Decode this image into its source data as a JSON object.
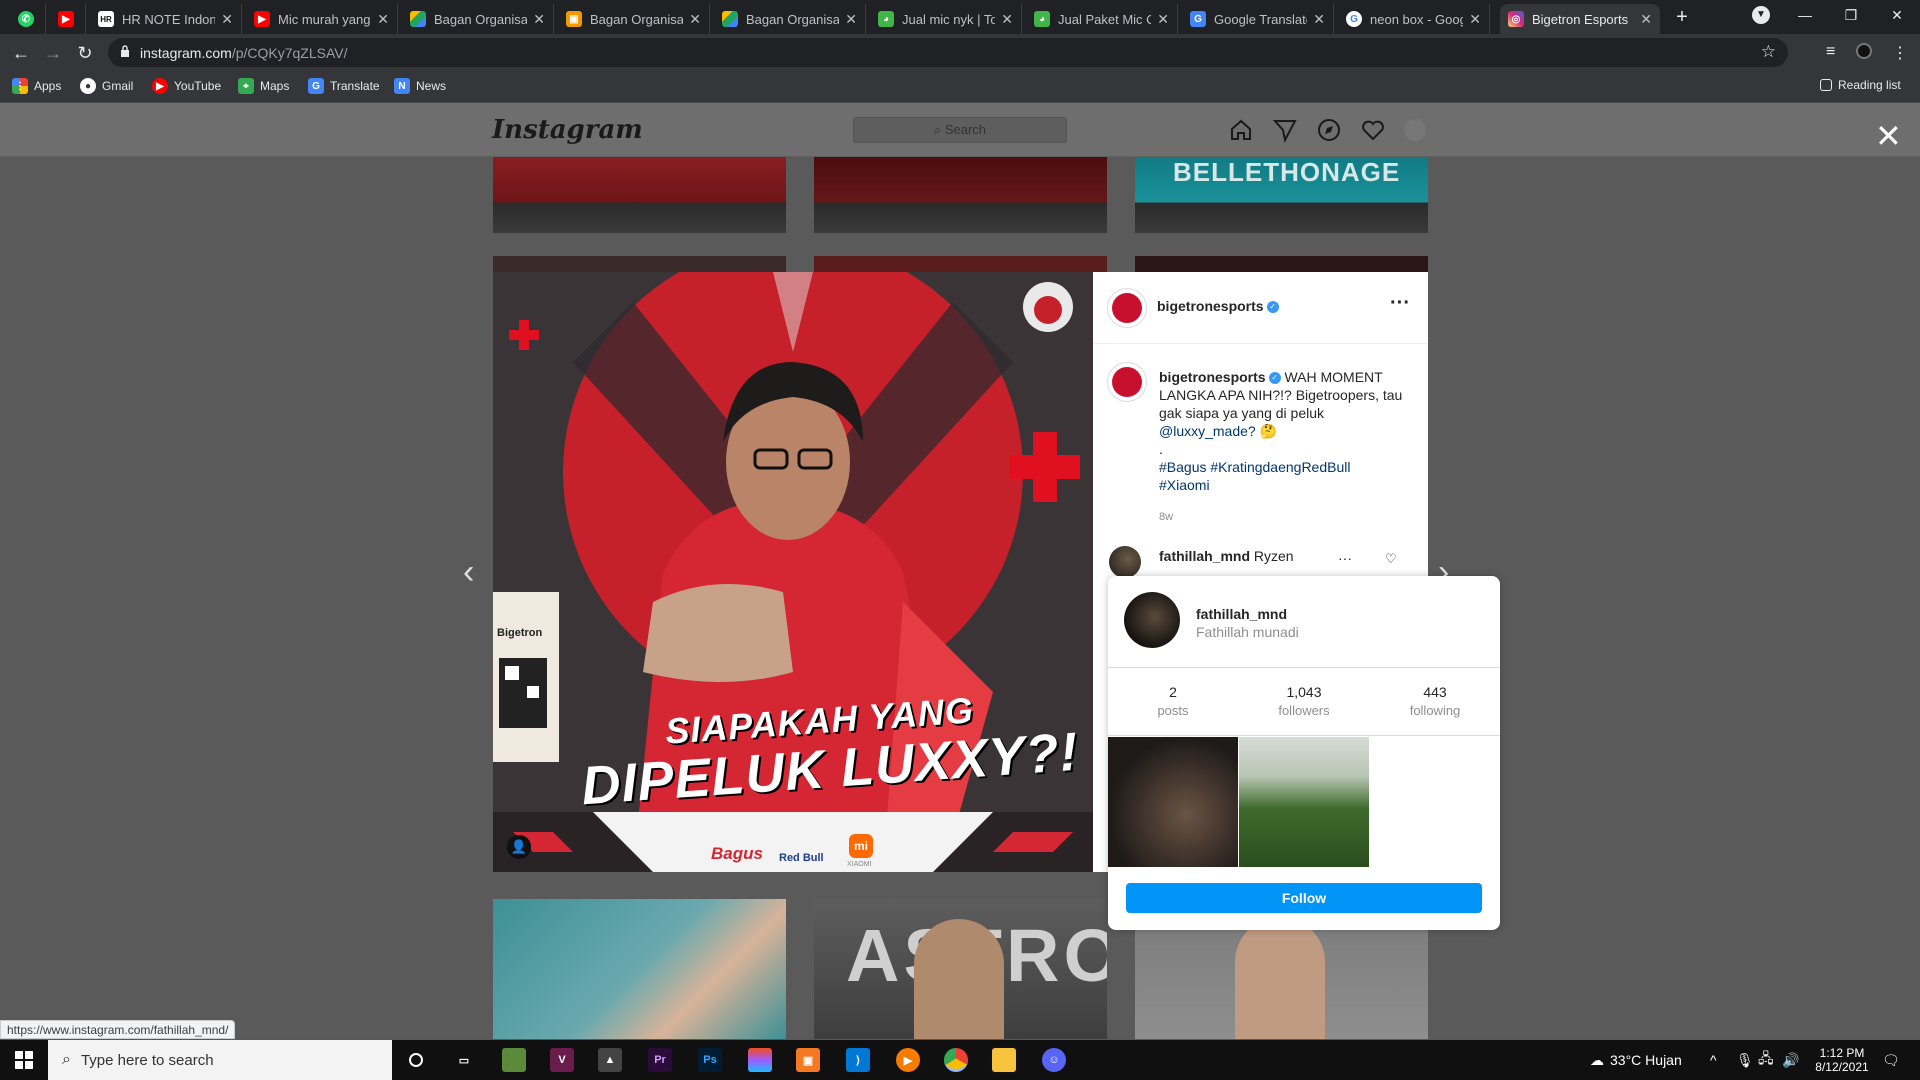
{
  "browser": {
    "tabs": [
      {
        "title": "",
        "favicon": "whatsapp-icon",
        "color": "#25d366"
      },
      {
        "title": "",
        "favicon": "youtube-icon",
        "color": "#ff0000"
      },
      {
        "title": "HR NOTE Indonesi",
        "favicon": "hr-note-icon",
        "color": "#1a1a1a"
      },
      {
        "title": "Mic murah yang c",
        "favicon": "youtube-icon",
        "color": "#ff0000"
      },
      {
        "title": "Bagan Organisasi",
        "favicon": "google-drive-icon",
        "color": "#1fa463"
      },
      {
        "title": "Bagan Organisasi",
        "favicon": "orange-doc-icon",
        "color": "#f29900"
      },
      {
        "title": "Bagan Organisasi",
        "favicon": "google-drive-icon",
        "color": "#1fa463"
      },
      {
        "title": "Jual mic nyk | Tok",
        "favicon": "tokopedia-icon",
        "color": "#42b549"
      },
      {
        "title": "Jual Paket Mic Co",
        "favicon": "tokopedia-icon",
        "color": "#42b549"
      },
      {
        "title": "Google Translate",
        "favicon": "translate-icon",
        "color": "#4285f4"
      },
      {
        "title": "neon box - Goog",
        "favicon": "google-icon",
        "color": "#ffffff"
      },
      {
        "title": "Bigetron Esports",
        "favicon": "instagram-icon",
        "color": "#e1306c"
      }
    ],
    "url_host": "instagram.com",
    "url_path": "/p/CQKy7qZLSAV/",
    "bookmarks": [
      {
        "label": "Apps",
        "icon": "apps-grid-icon",
        "color": "#ea4335"
      },
      {
        "label": "Gmail",
        "icon": "gmail-icon",
        "color": "#ffffff"
      },
      {
        "label": "YouTube",
        "icon": "youtube-icon",
        "color": "#ff0000"
      },
      {
        "label": "Maps",
        "icon": "maps-icon",
        "color": "#34a853"
      },
      {
        "label": "Translate",
        "icon": "translate-icon",
        "color": "#4285f4"
      },
      {
        "label": "News",
        "icon": "news-icon",
        "color": "#4285f4"
      }
    ],
    "reading_list": "Reading list",
    "status_url": "https://www.instagram.com/fathillah_mnd/"
  },
  "instagram": {
    "logo": "Instagram",
    "search_placeholder": "Search",
    "post": {
      "username": "bigetronesports",
      "caption_user": "bigetronesports",
      "caption_text": "WAH MOMENT LANGKA APA NIH?!? Bigetroopers, tau gak siapa ya yang di peluk",
      "mention": "@luxxy_made?",
      "emoji": "🤔",
      "dot": ".",
      "hashtags_line1": "#Bagus #KratingdaengRedBull",
      "hashtags_line2": "#Xiaomi",
      "time": "8w",
      "comment_user": "fathillah_mnd",
      "comment_text": "Ryzen",
      "image_text_line1": "SIAPAKAH YANG",
      "image_text_line2": "DIPELUK LUXXY?!",
      "sponsor1": "Bagus",
      "sponsor2": "Red Bull",
      "sponsor3": "XIAOMI",
      "banner_text": "Bigetron"
    },
    "hovercard": {
      "username": "fathillah_mnd",
      "fullname": "Fathillah munadi",
      "posts": "2",
      "posts_label": "posts",
      "followers": "1,043",
      "followers_label": "followers",
      "following": "443",
      "following_label": "following",
      "follow_label": "Follow"
    },
    "grid_texts": {
      "top_right": "BELLETHONAGE",
      "bottom_mid": "ASTRO"
    }
  },
  "taskbar": {
    "search_placeholder": "Type here to search",
    "weather": "33°C  Hujan",
    "time": "1:12 PM",
    "date": "8/12/2021"
  }
}
